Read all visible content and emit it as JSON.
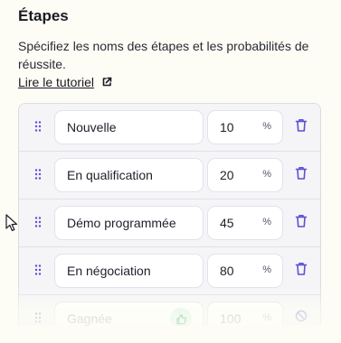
{
  "header": {
    "title": "Étapes",
    "description": "Spécifiez les noms des étapes et les probabilités de réussite.",
    "tutorial_link": "Lire le tutoriel"
  },
  "stages": [
    {
      "name": "Nouvelle",
      "probability": "10",
      "unit": "%"
    },
    {
      "name": "En qualification",
      "probability": "20",
      "unit": "%"
    },
    {
      "name": "Démo programmée",
      "probability": "45",
      "unit": "%"
    },
    {
      "name": "En négociation",
      "probability": "80",
      "unit": "%"
    },
    {
      "name": "Gagnée",
      "probability": "100",
      "unit": "%"
    }
  ],
  "icons": {
    "drag": "drag-handle-icon",
    "delete": "trash-icon",
    "external": "external-link-icon",
    "won": "thumbs-up-icon",
    "locked": "ban-icon"
  },
  "colors": {
    "accent": "#5b4fd6",
    "won_badge": "#d6f3e0",
    "won_icon": "#2f9e5b"
  }
}
